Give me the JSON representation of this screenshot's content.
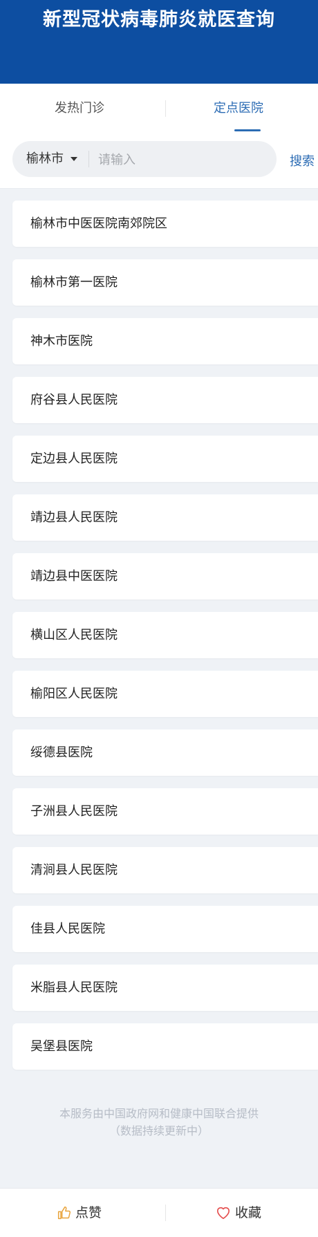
{
  "header": {
    "title": "新型冠状病毒肺炎就医查询"
  },
  "tabs": [
    {
      "label": "发热门诊",
      "active": false
    },
    {
      "label": "定点医院",
      "active": true
    }
  ],
  "search": {
    "city": "榆林市",
    "placeholder": "请输入",
    "button_label": "搜索"
  },
  "hospitals": [
    "榆林市中医医院南郊院区",
    "榆林市第一医院",
    "神木市医院",
    "府谷县人民医院",
    "定边县人民医院",
    "靖边县人民医院",
    "靖边县中医医院",
    "横山区人民医院",
    "榆阳区人民医院",
    "绥德县医院",
    "子洲县人民医院",
    "清涧县人民医院",
    "佳县人民医院",
    "米脂县人民医院",
    "吴堡县医院"
  ],
  "footer": {
    "line1": "本服务由中国政府网和健康中国联合提供",
    "line2": "（数据持续更新中）"
  },
  "bottom_bar": {
    "like_label": "点赞",
    "favorite_label": "收藏"
  },
  "colors": {
    "header_bg": "#0d4ea1",
    "accent": "#2c6cb4",
    "like_icon": "#e8a33b",
    "favorite_icon": "#e54d4d"
  },
  "icons": {
    "like": "thumbs-up-icon",
    "favorite": "heart-icon",
    "dropdown": "caret-down-icon"
  }
}
